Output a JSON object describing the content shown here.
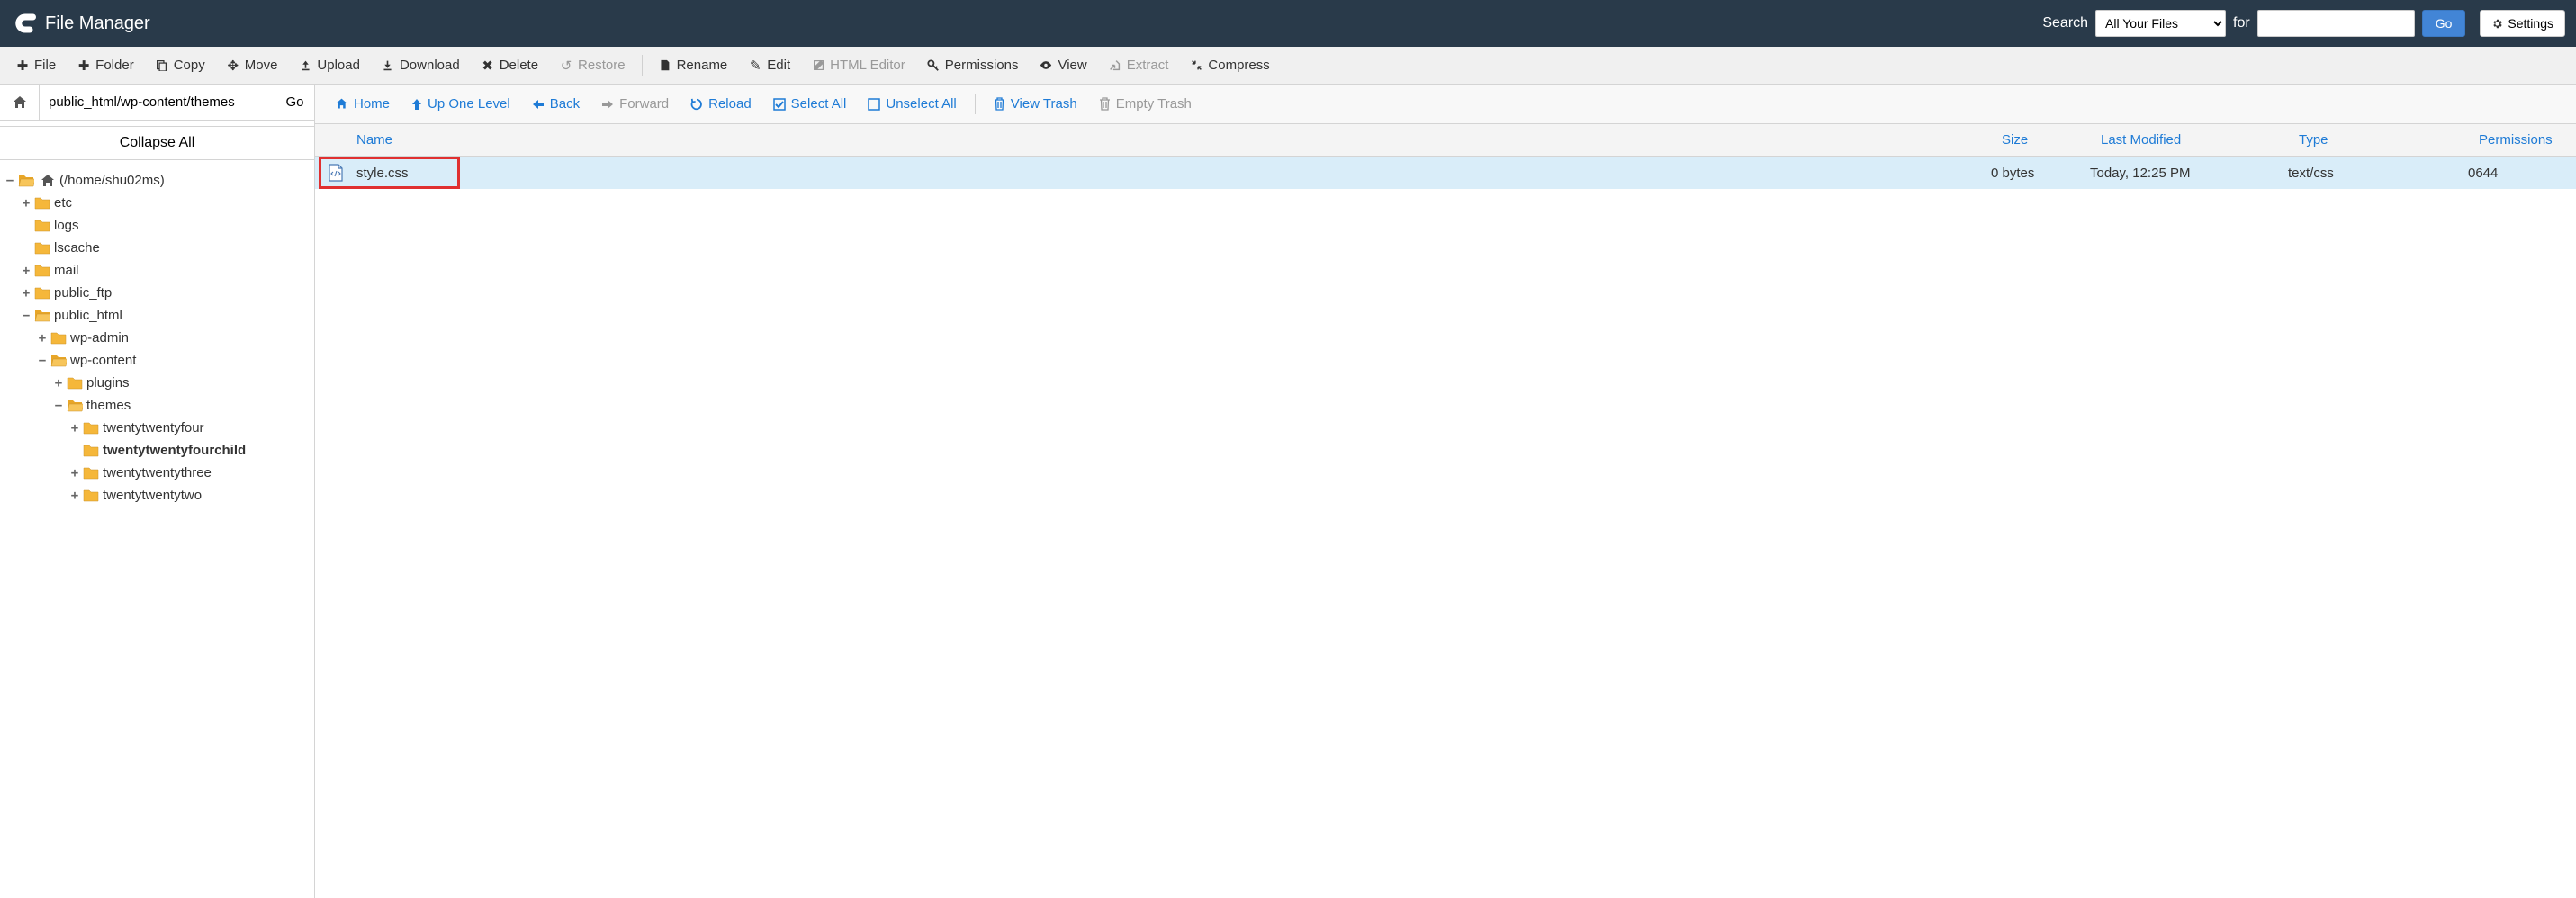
{
  "header": {
    "title": "File Manager",
    "search_label": "Search",
    "for_label": "for",
    "select_value": "All Your Files",
    "go": "Go",
    "settings": "Settings"
  },
  "toolbar": {
    "file": "File",
    "folder": "Folder",
    "copy": "Copy",
    "move": "Move",
    "upload": "Upload",
    "download": "Download",
    "delete": "Delete",
    "restore": "Restore",
    "rename": "Rename",
    "edit": "Edit",
    "html_editor": "HTML Editor",
    "permissions": "Permissions",
    "view": "View",
    "extract": "Extract",
    "compress": "Compress"
  },
  "sidebar": {
    "path": "public_html/wp-content/themes",
    "go": "Go",
    "collapse": "Collapse All",
    "root_label": "(/home/shu02ms)",
    "tree": {
      "etc": "etc",
      "logs": "logs",
      "lscache": "lscache",
      "mail": "mail",
      "public_ftp": "public_ftp",
      "public_html": "public_html",
      "wp_admin": "wp-admin",
      "wp_content": "wp-content",
      "plugins": "plugins",
      "themes": "themes",
      "tt4": "twentytwentyfour",
      "tt4child": "twentytwentyfourchild",
      "tt3": "twentytwentythree",
      "tt2": "twentytwentytwo"
    }
  },
  "nav": {
    "home": "Home",
    "up": "Up One Level",
    "back": "Back",
    "forward": "Forward",
    "reload": "Reload",
    "select_all": "Select All",
    "unselect_all": "Unselect All",
    "view_trash": "View Trash",
    "empty_trash": "Empty Trash"
  },
  "columns": {
    "name": "Name",
    "size": "Size",
    "modified": "Last Modified",
    "type": "Type",
    "permissions": "Permissions"
  },
  "rows": [
    {
      "name": "style.css",
      "size": "0 bytes",
      "modified": "Today, 12:25 PM",
      "type": "text/css",
      "permissions": "0644"
    }
  ]
}
